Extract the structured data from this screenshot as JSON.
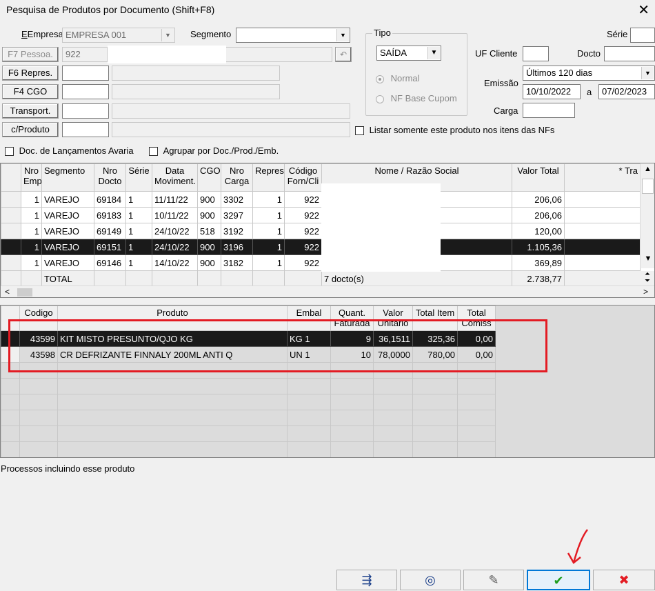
{
  "window": {
    "title": "Pesquisa de Produtos por Documento     (Shift+F8)",
    "close": "✕"
  },
  "form": {
    "empresa_label": "Empresa",
    "empresa_value": "EMPRESA 001",
    "segmento_label": "Segmento",
    "segmento_value": "",
    "pessoa_btn": "F7 Pessoa.",
    "pessoa_value": "922",
    "repres_btn": "F6 Repres.",
    "cgo_btn": "F4 CGO",
    "transport_btn": "Transport.",
    "cproduto_btn": "c/Produto",
    "tipo_label": "Tipo",
    "tipo_value": "SAÍDA",
    "radio_normal": "Normal",
    "radio_nfbase": "NF Base Cupom",
    "uf_label": "UF Cliente",
    "uf_value": "",
    "docto_label": "Docto",
    "docto_value": "",
    "serie_label": "Série",
    "emissao_label": "Emissão",
    "emissao_value": "Últimos 120 dias",
    "data_ini": "10/10/2022",
    "a_label": "a",
    "data_fim": "07/02/2023",
    "carga_label": "Carga",
    "carga_value": "",
    "listar_label": "Listar somente este produto nos itens das NFs",
    "avaria_label": "Doc. de Lançamentos Avaria",
    "agrupar_label": "Agrupar por Doc./Prod./Emb."
  },
  "docs_grid": {
    "headers": [
      "Nro Emp",
      "Segmento",
      "Nro Docto",
      "Série",
      "Data Moviment.",
      "CGO",
      "Nro Carga",
      "Repres",
      "Código Forn/Cli",
      "Nome / Razão Social",
      "Valor Total",
      "* Tra"
    ],
    "rows": [
      [
        "1",
        "VAREJO",
        "69184",
        "1",
        "11/11/22",
        "900",
        "3302",
        "1",
        "922",
        "",
        "206,06"
      ],
      [
        "1",
        "VAREJO",
        "69183",
        "1",
        "10/11/22",
        "900",
        "3297",
        "1",
        "922",
        "",
        "206,06"
      ],
      [
        "1",
        "VAREJO",
        "69149",
        "1",
        "24/10/22",
        "518",
        "3192",
        "1",
        "922",
        "",
        "120,00"
      ],
      [
        "1",
        "VAREJO",
        "69151",
        "1",
        "24/10/22",
        "900",
        "3196",
        "1",
        "922",
        "",
        "1.105,36"
      ],
      [
        "1",
        "VAREJO",
        "69146",
        "1",
        "14/10/22",
        "900",
        "3182",
        "1",
        "922",
        "",
        "369,89"
      ]
    ],
    "total_label": "TOTAL",
    "total_count": "7 docto(s)",
    "total_value": "2.738,77"
  },
  "items_grid": {
    "headers": [
      "Codigo",
      "Produto",
      "Embal",
      "Quant. Faturada",
      "Valor Unitário",
      "Total Item",
      "Total Comiss"
    ],
    "rows": [
      [
        "43599",
        "KIT MISTO PRESUNTO/QJO KG",
        "KG 1",
        "9",
        "36,1511",
        "325,36",
        "0,00"
      ],
      [
        "43598",
        "CR DEFRIZANTE FINNALY 200ML ANTI Q",
        "UN 1",
        "10",
        "78,0000",
        "780,00",
        "0,00"
      ]
    ]
  },
  "status": {
    "processos": "Processos incluindo esse produto"
  },
  "toolbar": {
    "buttons": [
      {
        "icon": "export-icon",
        "glyph": "⇶"
      },
      {
        "icon": "binoculars-icon",
        "glyph": "◎"
      },
      {
        "icon": "eraser-icon",
        "glyph": "✎"
      },
      {
        "icon": "check-icon",
        "glyph": "✔"
      },
      {
        "icon": "cancel-icon",
        "glyph": "✖"
      }
    ]
  },
  "colors": {
    "accent": "#0078d7",
    "highlight": "#e31b23",
    "check": "#1f9e1f",
    "cancel": "#e31b23",
    "selected_row": "#1a1a1a"
  }
}
